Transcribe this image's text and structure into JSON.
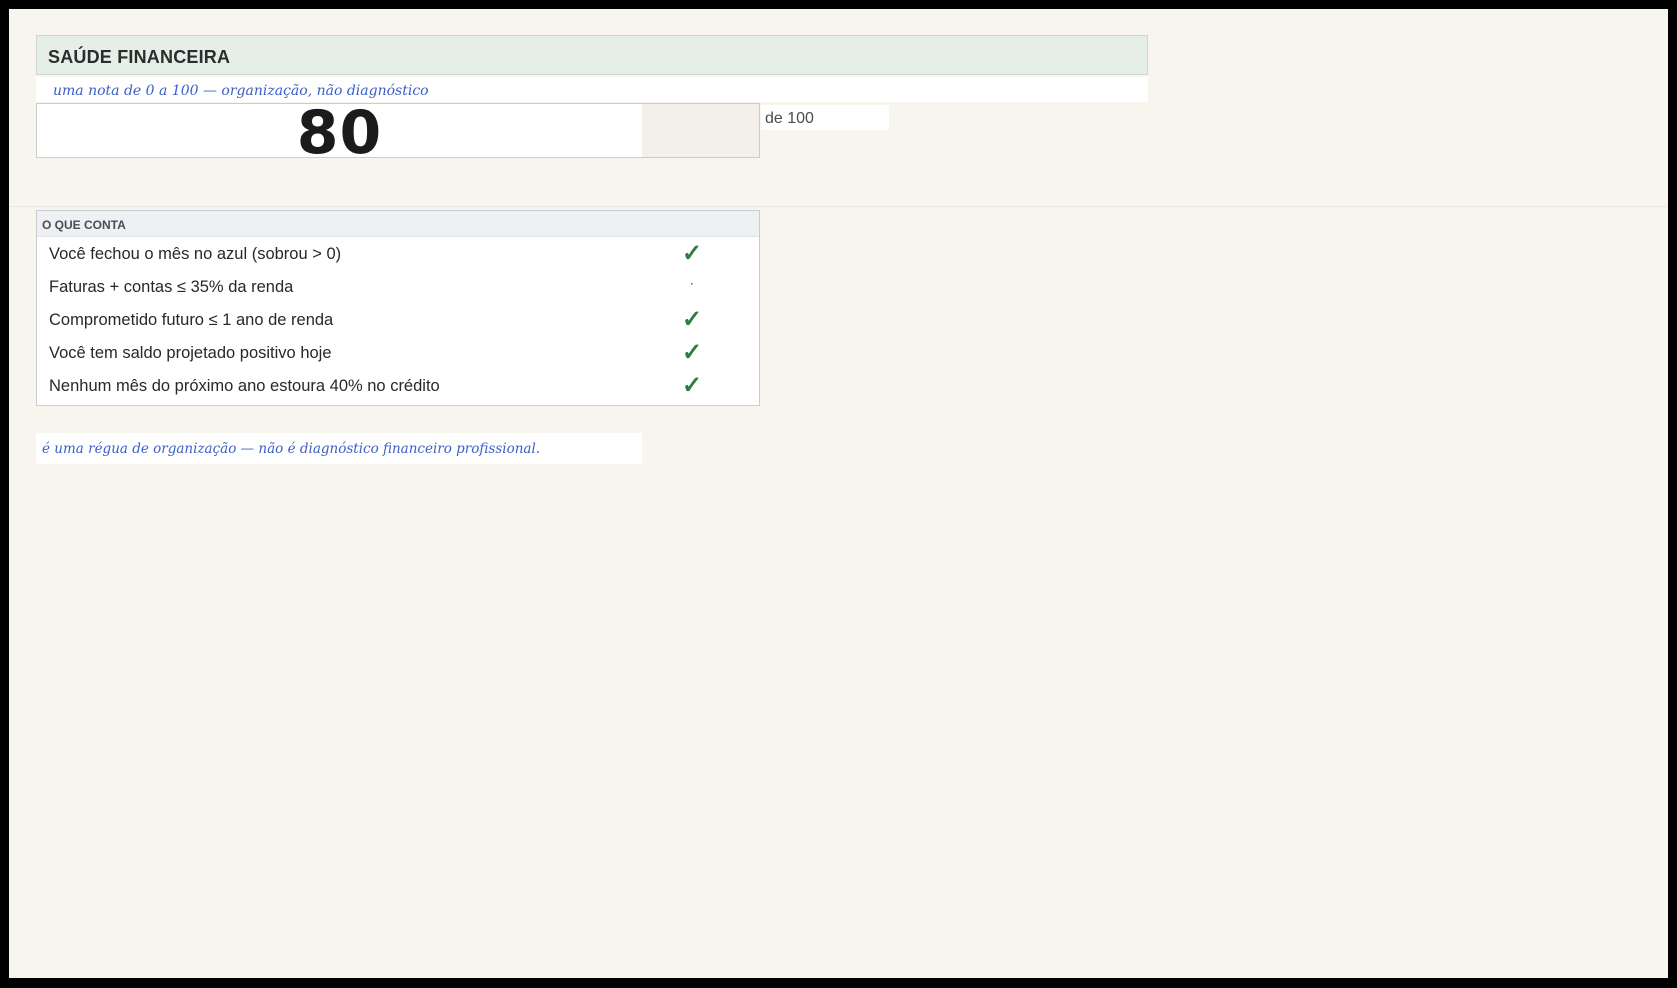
{
  "header": {
    "title": "SAÚDE FINANCEIRA"
  },
  "subtitle": "uma nota de 0 a 100 — organização, não diagnóstico",
  "score": {
    "value": "80",
    "suffix": "de 100"
  },
  "checklist": {
    "title": "O QUE CONTA",
    "items": [
      {
        "label": "Você fechou o mês no azul (sobrou > 0)",
        "mark": "✓",
        "status": "met"
      },
      {
        "label": "Faturas + contas ≤ 35% da renda",
        "mark": "·",
        "status": "not-met"
      },
      {
        "label": "Comprometido futuro ≤ 1 ano de renda",
        "mark": "✓",
        "status": "met"
      },
      {
        "label": "Você tem saldo projetado positivo hoje",
        "mark": "✓",
        "status": "met"
      },
      {
        "label": "Nenhum mês do próximo ano estoura 40% no crédito",
        "mark": "✓",
        "status": "met"
      }
    ]
  },
  "disclaimer": "é uma régua de organização — não é diagnóstico financeiro profissional.",
  "colors": {
    "accent_green": "#2e7d3e",
    "note_blue": "#3b5fc8",
    "header_band": "#e5efe7",
    "background": "#f8f5ef"
  },
  "icons": {
    "met": "check-icon",
    "not-met": "dot-icon"
  }
}
